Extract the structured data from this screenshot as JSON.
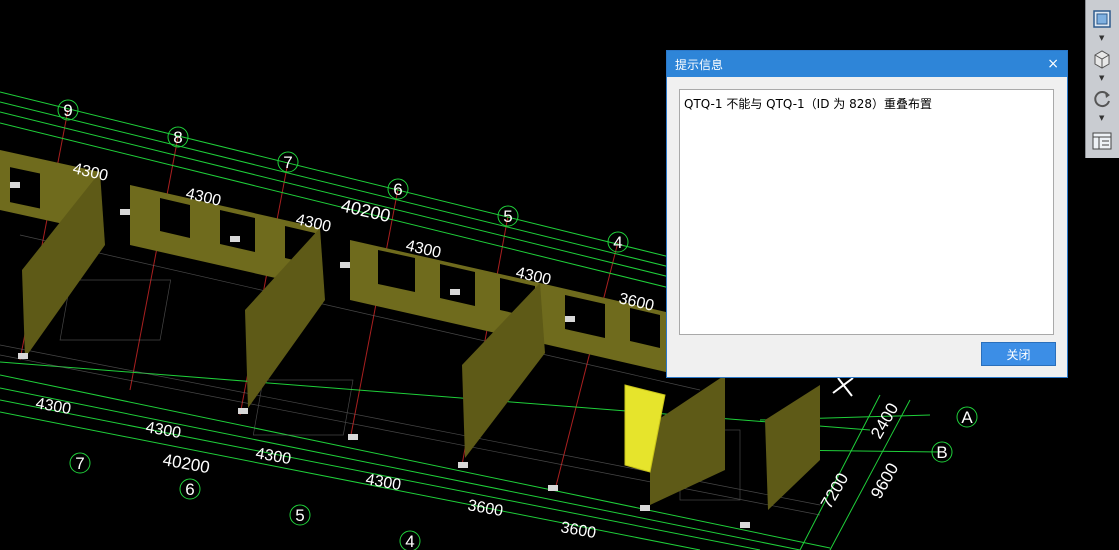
{
  "dialog": {
    "title": "提示信息",
    "message": "QTQ-1 不能与 QTQ-1（ID 为 828）重叠布置",
    "close_button": "关闭",
    "close_icon": "×"
  },
  "toolbar": {
    "items": [
      {
        "icon": "view-box-icon"
      },
      {
        "icon": "cube-icon"
      },
      {
        "icon": "rotate-icon"
      },
      {
        "icon": "properties-panel-icon"
      }
    ]
  },
  "drawing": {
    "axis_numbers": [
      "9",
      "8",
      "7",
      "6",
      "5",
      "4"
    ],
    "axis_letters": [
      "A",
      "B"
    ],
    "top_dimensions": [
      "4300",
      "4300",
      "4300",
      "4300",
      "4300",
      "3600"
    ],
    "top_total": "40200",
    "bottom_dimensions": [
      "4300",
      "4300",
      "4300",
      "4300",
      "3600",
      "3600"
    ],
    "bottom_total": "40200",
    "right_dimensions": [
      "2400",
      "7200",
      "9600"
    ],
    "bottom_axis_numbers": [
      "7",
      "6",
      "5",
      "4"
    ],
    "colors": {
      "wall": "#6f6b1d",
      "wall_dark": "#4f4c12",
      "wall_selected": "#e6e42c",
      "grid_green": "#1fcf3a",
      "axis_red": "#d42828"
    }
  }
}
